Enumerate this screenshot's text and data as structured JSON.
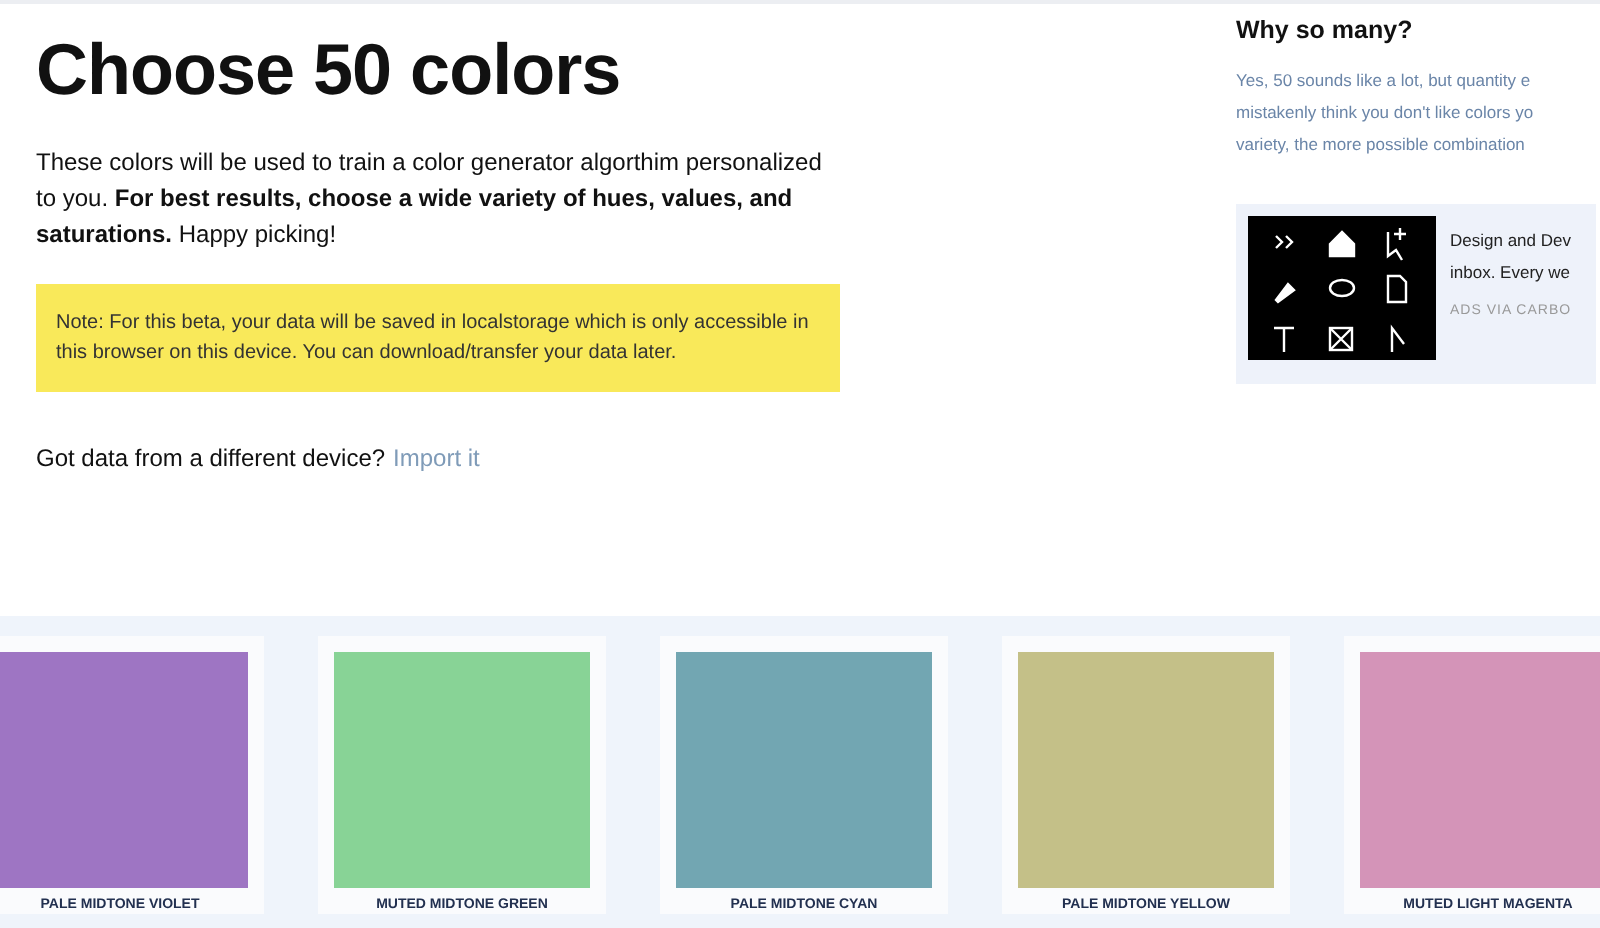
{
  "title": "Choose 50 colors",
  "intro": "These colors will be used to train a color generator algorthim personalized to you. **For best results, choose a wide variety of hues, values, and saturations.** Happy picking!",
  "note": "Note: For this beta, your data will be saved in localstorage which is only accessible in this browser on this device. You can download/transfer your data later.",
  "import": {
    "text": "Got data from a different device?",
    "link": "Import it"
  },
  "sidebar": {
    "heading": "Why so many?",
    "lines": [
      "Yes, 50 sounds like a lot, but quantity e",
      "mistakenly think you don't like colors yo",
      "variety, the more possible combination"
    ]
  },
  "ad": {
    "lines": [
      "Design and Dev",
      "inbox. Every we"
    ],
    "credit": "ADS VIA CARBO"
  },
  "swatches": [
    {
      "name": "PALE MIDTONE VIOLET",
      "color": "#9e75c3"
    },
    {
      "name": "MUTED MIDTONE GREEN",
      "color": "#88d396"
    },
    {
      "name": "PALE MIDTONE CYAN",
      "color": "#72a6b2"
    },
    {
      "name": "PALE MIDTONE YELLOW",
      "color": "#c4c088"
    },
    {
      "name": "MUTED LIGHT MAGENTA",
      "color": "#d494b8"
    }
  ]
}
